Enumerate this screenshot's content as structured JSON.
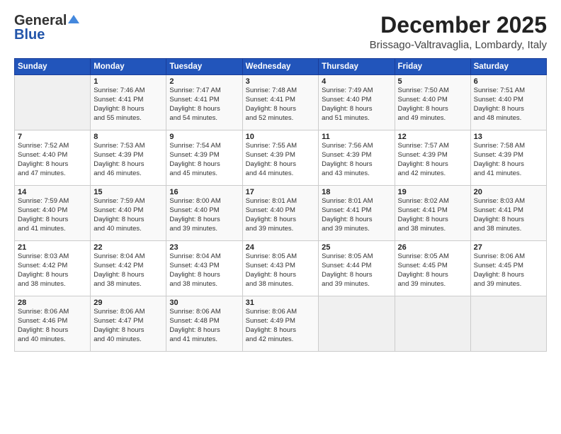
{
  "header": {
    "logo_general": "General",
    "logo_blue": "Blue",
    "month": "December 2025",
    "location": "Brissago-Valtravaglia, Lombardy, Italy"
  },
  "weekdays": [
    "Sunday",
    "Monday",
    "Tuesday",
    "Wednesday",
    "Thursday",
    "Friday",
    "Saturday"
  ],
  "weeks": [
    [
      {
        "day": "",
        "info": ""
      },
      {
        "day": "1",
        "info": "Sunrise: 7:46 AM\nSunset: 4:41 PM\nDaylight: 8 hours\nand 55 minutes."
      },
      {
        "day": "2",
        "info": "Sunrise: 7:47 AM\nSunset: 4:41 PM\nDaylight: 8 hours\nand 54 minutes."
      },
      {
        "day": "3",
        "info": "Sunrise: 7:48 AM\nSunset: 4:41 PM\nDaylight: 8 hours\nand 52 minutes."
      },
      {
        "day": "4",
        "info": "Sunrise: 7:49 AM\nSunset: 4:40 PM\nDaylight: 8 hours\nand 51 minutes."
      },
      {
        "day": "5",
        "info": "Sunrise: 7:50 AM\nSunset: 4:40 PM\nDaylight: 8 hours\nand 49 minutes."
      },
      {
        "day": "6",
        "info": "Sunrise: 7:51 AM\nSunset: 4:40 PM\nDaylight: 8 hours\nand 48 minutes."
      }
    ],
    [
      {
        "day": "7",
        "info": "Sunrise: 7:52 AM\nSunset: 4:40 PM\nDaylight: 8 hours\nand 47 minutes."
      },
      {
        "day": "8",
        "info": "Sunrise: 7:53 AM\nSunset: 4:39 PM\nDaylight: 8 hours\nand 46 minutes."
      },
      {
        "day": "9",
        "info": "Sunrise: 7:54 AM\nSunset: 4:39 PM\nDaylight: 8 hours\nand 45 minutes."
      },
      {
        "day": "10",
        "info": "Sunrise: 7:55 AM\nSunset: 4:39 PM\nDaylight: 8 hours\nand 44 minutes."
      },
      {
        "day": "11",
        "info": "Sunrise: 7:56 AM\nSunset: 4:39 PM\nDaylight: 8 hours\nand 43 minutes."
      },
      {
        "day": "12",
        "info": "Sunrise: 7:57 AM\nSunset: 4:39 PM\nDaylight: 8 hours\nand 42 minutes."
      },
      {
        "day": "13",
        "info": "Sunrise: 7:58 AM\nSunset: 4:39 PM\nDaylight: 8 hours\nand 41 minutes."
      }
    ],
    [
      {
        "day": "14",
        "info": "Sunrise: 7:59 AM\nSunset: 4:40 PM\nDaylight: 8 hours\nand 41 minutes."
      },
      {
        "day": "15",
        "info": "Sunrise: 7:59 AM\nSunset: 4:40 PM\nDaylight: 8 hours\nand 40 minutes."
      },
      {
        "day": "16",
        "info": "Sunrise: 8:00 AM\nSunset: 4:40 PM\nDaylight: 8 hours\nand 39 minutes."
      },
      {
        "day": "17",
        "info": "Sunrise: 8:01 AM\nSunset: 4:40 PM\nDaylight: 8 hours\nand 39 minutes."
      },
      {
        "day": "18",
        "info": "Sunrise: 8:01 AM\nSunset: 4:41 PM\nDaylight: 8 hours\nand 39 minutes."
      },
      {
        "day": "19",
        "info": "Sunrise: 8:02 AM\nSunset: 4:41 PM\nDaylight: 8 hours\nand 38 minutes."
      },
      {
        "day": "20",
        "info": "Sunrise: 8:03 AM\nSunset: 4:41 PM\nDaylight: 8 hours\nand 38 minutes."
      }
    ],
    [
      {
        "day": "21",
        "info": "Sunrise: 8:03 AM\nSunset: 4:42 PM\nDaylight: 8 hours\nand 38 minutes."
      },
      {
        "day": "22",
        "info": "Sunrise: 8:04 AM\nSunset: 4:42 PM\nDaylight: 8 hours\nand 38 minutes."
      },
      {
        "day": "23",
        "info": "Sunrise: 8:04 AM\nSunset: 4:43 PM\nDaylight: 8 hours\nand 38 minutes."
      },
      {
        "day": "24",
        "info": "Sunrise: 8:05 AM\nSunset: 4:43 PM\nDaylight: 8 hours\nand 38 minutes."
      },
      {
        "day": "25",
        "info": "Sunrise: 8:05 AM\nSunset: 4:44 PM\nDaylight: 8 hours\nand 39 minutes."
      },
      {
        "day": "26",
        "info": "Sunrise: 8:05 AM\nSunset: 4:45 PM\nDaylight: 8 hours\nand 39 minutes."
      },
      {
        "day": "27",
        "info": "Sunrise: 8:06 AM\nSunset: 4:45 PM\nDaylight: 8 hours\nand 39 minutes."
      }
    ],
    [
      {
        "day": "28",
        "info": "Sunrise: 8:06 AM\nSunset: 4:46 PM\nDaylight: 8 hours\nand 40 minutes."
      },
      {
        "day": "29",
        "info": "Sunrise: 8:06 AM\nSunset: 4:47 PM\nDaylight: 8 hours\nand 40 minutes."
      },
      {
        "day": "30",
        "info": "Sunrise: 8:06 AM\nSunset: 4:48 PM\nDaylight: 8 hours\nand 41 minutes."
      },
      {
        "day": "31",
        "info": "Sunrise: 8:06 AM\nSunset: 4:49 PM\nDaylight: 8 hours\nand 42 minutes."
      },
      {
        "day": "",
        "info": ""
      },
      {
        "day": "",
        "info": ""
      },
      {
        "day": "",
        "info": ""
      }
    ]
  ]
}
